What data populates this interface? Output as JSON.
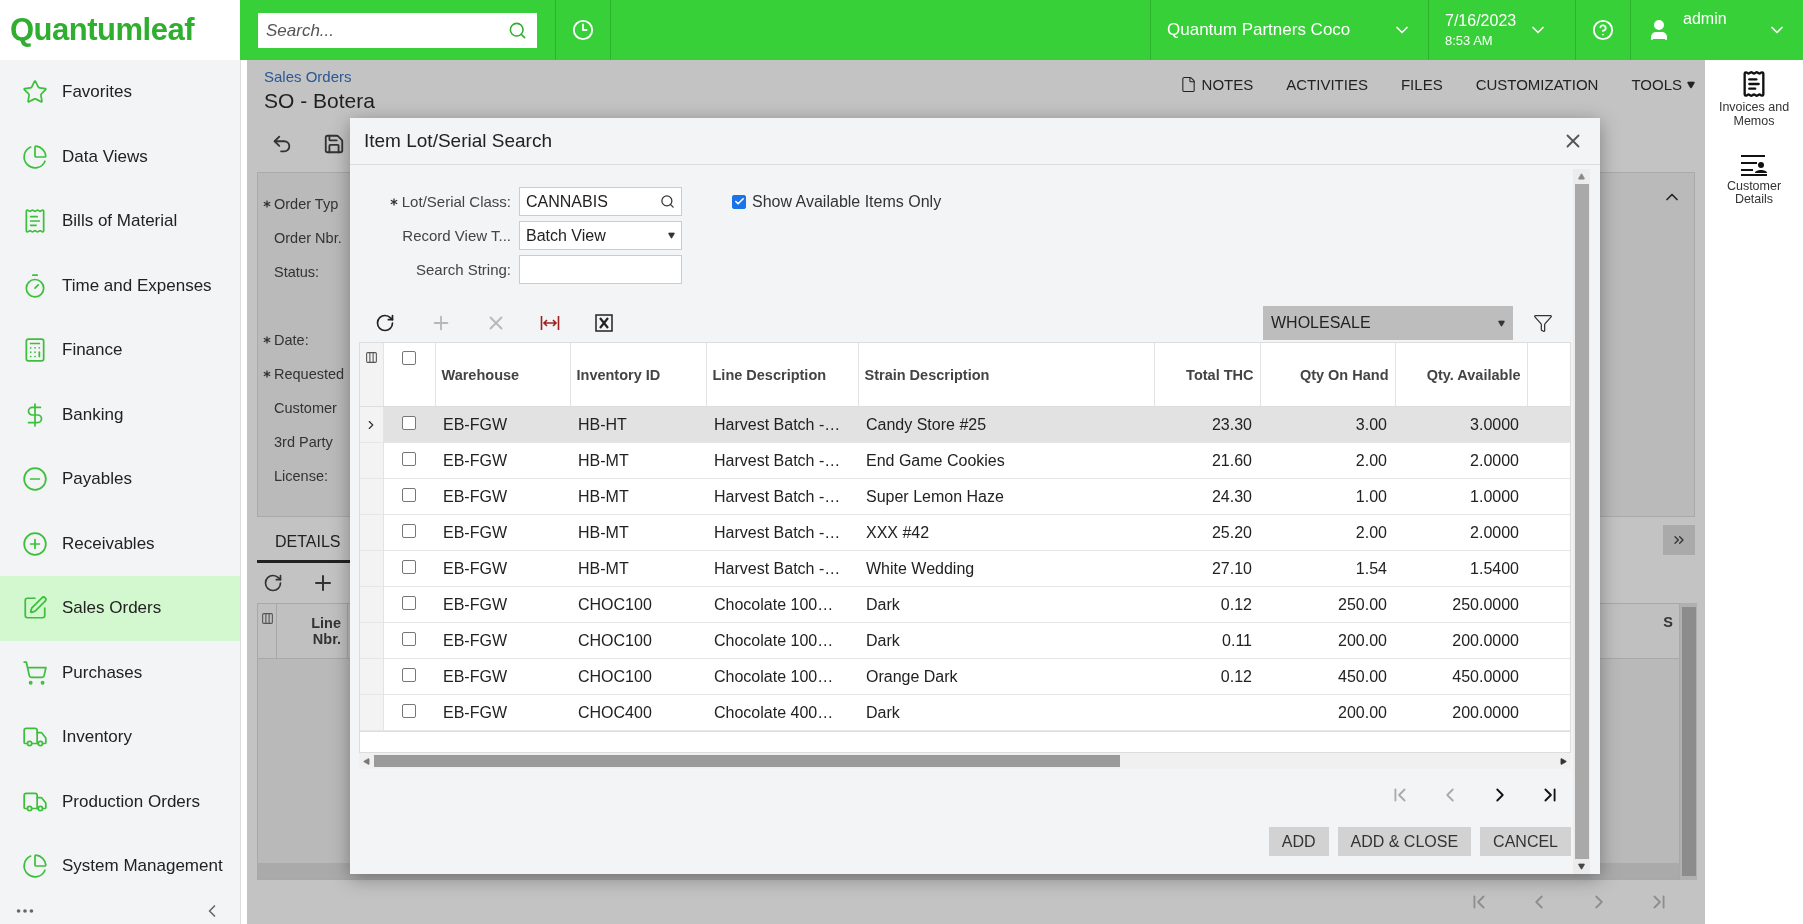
{
  "topbar": {
    "logo": "Quantumleaf",
    "search": {
      "placeholder": "Search..."
    },
    "company": "Quantum Partners Coco",
    "date": "7/16/2023",
    "time": "8:53 AM",
    "user": "admin"
  },
  "sidebar": {
    "items": [
      {
        "label": "Favorites",
        "selected": false
      },
      {
        "label": "Data Views",
        "selected": false
      },
      {
        "label": "Bills of Material",
        "selected": false
      },
      {
        "label": "Time and Expenses",
        "selected": false
      },
      {
        "label": "Finance",
        "selected": false
      },
      {
        "label": "Banking",
        "selected": false
      },
      {
        "label": "Payables",
        "selected": false
      },
      {
        "label": "Receivables",
        "selected": false
      },
      {
        "label": "Sales Orders",
        "selected": true
      },
      {
        "label": "Purchases",
        "selected": false
      },
      {
        "label": "Inventory",
        "selected": false
      },
      {
        "label": "Production Orders",
        "selected": false
      },
      {
        "label": "System Management",
        "selected": false
      }
    ]
  },
  "page": {
    "breadcrumb": "Sales Orders",
    "title": "SO - Botera",
    "actions": [
      {
        "label": "NOTES",
        "kind": "icon"
      },
      {
        "label": "ACTIVITIES",
        "kind": "plain"
      },
      {
        "label": "FILES",
        "kind": "plain"
      },
      {
        "label": "CUSTOMIZATION",
        "kind": "plain"
      },
      {
        "label": "TOOLS",
        "kind": "menu"
      }
    ],
    "form_groups": [
      [
        {
          "label": "Order Typ",
          "required": true
        },
        {
          "label": "Order Nbr.",
          "required": false
        },
        {
          "label": "Status:",
          "required": false
        }
      ],
      [
        {
          "label": "Date:",
          "required": true
        },
        {
          "label": "Requested",
          "required": true
        },
        {
          "label": "Customer",
          "required": false
        },
        {
          "label": "3rd Party",
          "required": false
        },
        {
          "label": "License:",
          "required": false
        }
      ]
    ],
    "tabs": [
      {
        "label": "DETAILS",
        "selected": true
      }
    ],
    "grid_columns": [
      "Line Nbr.",
      "S"
    ]
  },
  "right_panel": {
    "items": [
      {
        "label": "Invoices and Memos"
      },
      {
        "label": "Customer Details"
      }
    ]
  },
  "dialog": {
    "title": "Item Lot/Serial Search",
    "fields": [
      {
        "label": "Lot/Serial Class:",
        "required": true,
        "kind": "lookup",
        "value": "CANNABIS"
      },
      {
        "label": "Record View T...",
        "required": false,
        "kind": "select",
        "value": "Batch View"
      },
      {
        "label": "Search String:",
        "required": false,
        "kind": "text"
      }
    ],
    "show_available": {
      "label": "Show Available Items Only",
      "checked": true
    },
    "tools": [
      {
        "disabled": false
      },
      {
        "disabled": true
      },
      {
        "disabled": true
      },
      {
        "disabled": false
      },
      {
        "disabled": false
      }
    ],
    "filter": "WHOLESALE",
    "all_checked": false,
    "columns": [
      "Warehouse",
      "Inventory ID",
      "Line Description",
      "Strain Description",
      "Total THC",
      "Qty On Hand",
      "Qty. Available"
    ],
    "rows": [
      {
        "selected": true,
        "checked": false,
        "cells": [
          "EB-FGW",
          "HB-HT",
          "Harvest Batch -…",
          "Candy Store #25",
          "23.30",
          "3.00",
          "3.0000"
        ]
      },
      {
        "selected": false,
        "checked": false,
        "cells": [
          "EB-FGW",
          "HB-MT",
          "Harvest Batch -…",
          "End Game Cookies",
          "21.60",
          "2.00",
          "2.0000"
        ]
      },
      {
        "selected": false,
        "checked": false,
        "cells": [
          "EB-FGW",
          "HB-MT",
          "Harvest Batch -…",
          "Super Lemon Haze",
          "24.30",
          "1.00",
          "1.0000"
        ]
      },
      {
        "selected": false,
        "checked": false,
        "cells": [
          "EB-FGW",
          "HB-MT",
          "Harvest Batch -…",
          "XXX #42",
          "25.20",
          "2.00",
          "2.0000"
        ]
      },
      {
        "selected": false,
        "checked": false,
        "cells": [
          "EB-FGW",
          "HB-MT",
          "Harvest Batch -…",
          "White Wedding",
          "27.10",
          "1.54",
          "1.5400"
        ]
      },
      {
        "selected": false,
        "checked": false,
        "cells": [
          "EB-FGW",
          "CHOC100",
          "Chocolate 100…",
          "Dark",
          "0.12",
          "250.00",
          "250.0000"
        ]
      },
      {
        "selected": false,
        "checked": false,
        "cells": [
          "EB-FGW",
          "CHOC100",
          "Chocolate 100…",
          "Dark",
          "0.11",
          "200.00",
          "200.0000"
        ]
      },
      {
        "selected": false,
        "checked": false,
        "cells": [
          "EB-FGW",
          "CHOC100",
          "Chocolate 100…",
          "Orange Dark",
          "0.12",
          "450.00",
          "450.0000"
        ]
      },
      {
        "selected": false,
        "checked": false,
        "cells": [
          "EB-FGW",
          "CHOC400",
          "Chocolate 400…",
          "Dark",
          "",
          "200.00",
          "200.0000"
        ]
      }
    ],
    "pager": [
      {
        "disabled": true
      },
      {
        "disabled": true
      },
      {
        "disabled": false
      },
      {
        "disabled": false
      }
    ],
    "buttons": [
      "ADD",
      "ADD & CLOSE",
      "CANCEL"
    ]
  }
}
